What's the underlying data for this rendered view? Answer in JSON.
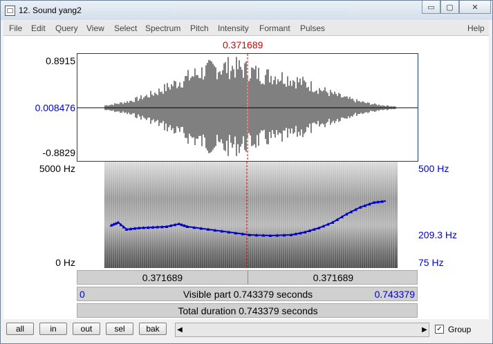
{
  "window": {
    "title": "12. Sound yang2"
  },
  "title_buttons": {
    "minimize": "▭",
    "maximize": "▢",
    "close": "✕"
  },
  "menu": [
    "File",
    "Edit",
    "Query",
    "View",
    "Select",
    "Spectrum",
    "Pitch",
    "Intensity",
    "Formant",
    "Pulses",
    "Help"
  ],
  "cursor": {
    "time": "0.371689"
  },
  "waveform": {
    "max": "0.8915",
    "cursor_value": "0.008476",
    "min": "-0.8829"
  },
  "spectrogram": {
    "freq_max": "5000 Hz",
    "freq_min": "0 Hz",
    "pitch_max": "500 Hz",
    "pitch_cursor": "209.3 Hz",
    "pitch_min": "75 Hz"
  },
  "bars": {
    "left_segment": "0.371689",
    "right_segment": "0.371689",
    "visible_start": "0",
    "visible_label": "Visible part 0.743379 seconds",
    "visible_end": "0.743379",
    "total_label": "Total duration 0.743379 seconds"
  },
  "toolbar": {
    "all": "all",
    "in": "in",
    "out": "out",
    "sel": "sel",
    "bak": "bak",
    "group_label": "Group",
    "group_checked": "✓"
  },
  "colors": {
    "cursor": "#d40000",
    "pitch": "#0000c8",
    "waveform": "#000000"
  }
}
